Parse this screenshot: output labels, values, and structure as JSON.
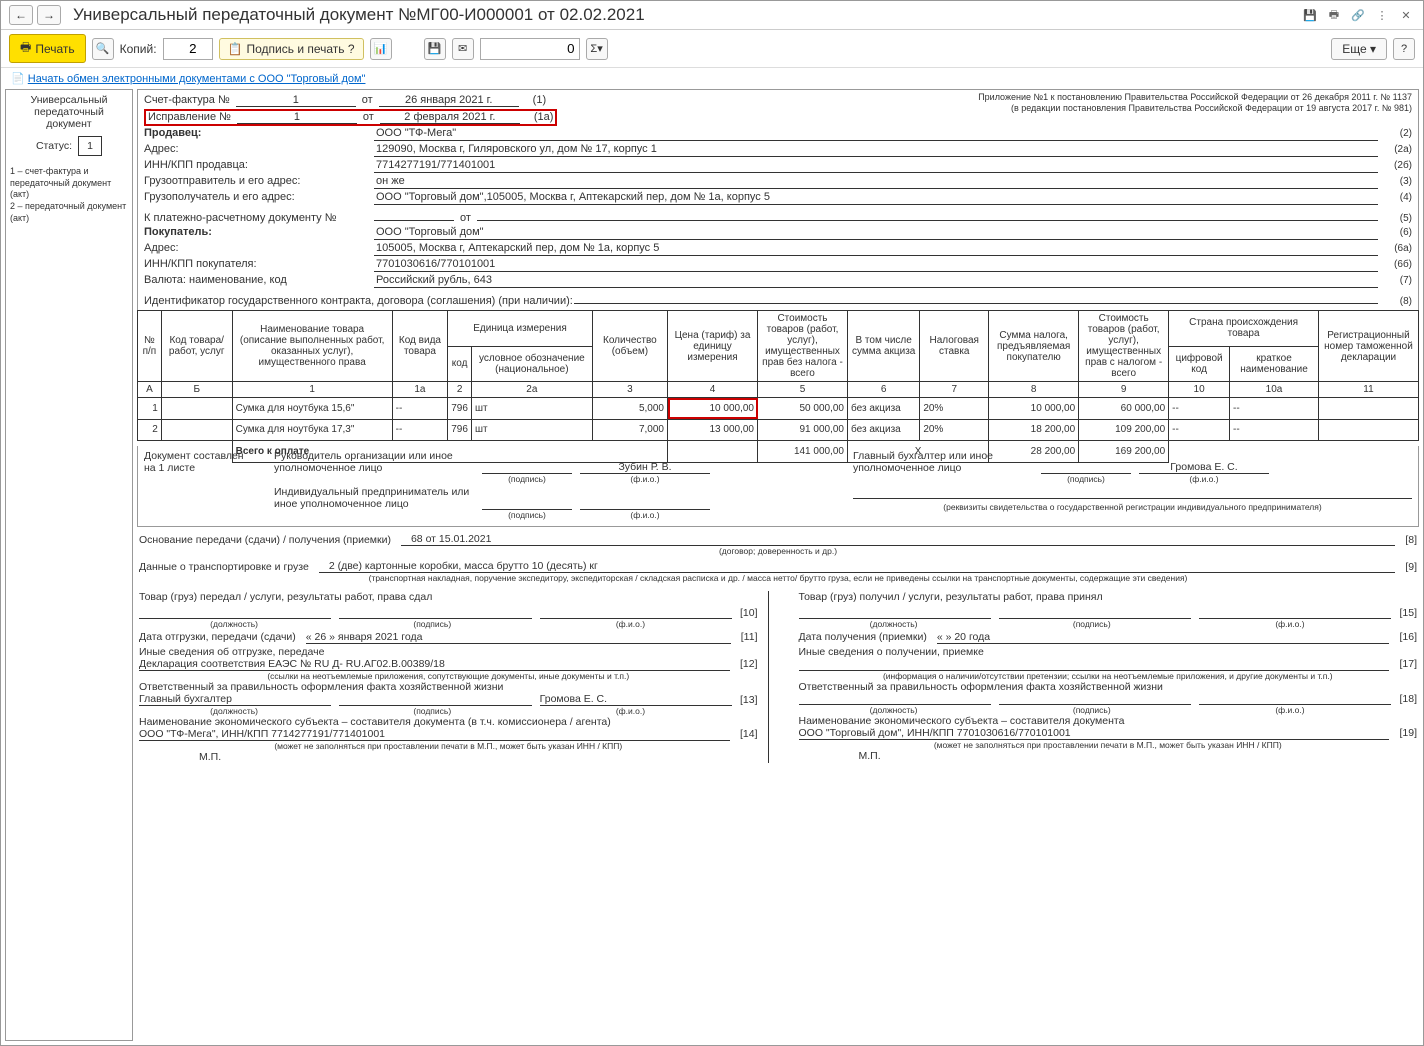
{
  "title": "Универсальный передаточный документ №МГ00-И000001 от 02.02.2021",
  "toolbar": {
    "print": "Печать",
    "copies_label": "Копий:",
    "copies": "2",
    "sign": "Подпись и печать ?",
    "sum": "0",
    "more": "Еще"
  },
  "link": "Начать обмен электронными документами с ООО \"Торговый дом\"",
  "sidebar": {
    "title": "Универсальный передаточный документ",
    "status_label": "Статус:",
    "status": "1",
    "note": "1 – счет-фактура и передаточный документ (акт)\n2 – передаточный документ (акт)"
  },
  "appendix1": "Приложение №1 к постановлению Правительства Российской Федерации от 26 декабря 2011 г. № 1137",
  "appendix2": "(в редакции постановления Правительства Российской Федерации от 19 августа 2017 г. № 981)",
  "sf": {
    "label": "Счет-фактура №",
    "num": "1",
    "ot": "от",
    "date": "26 января 2021 г.",
    "code": "(1)"
  },
  "corr": {
    "label": "Исправление №",
    "num": "1",
    "ot": "от",
    "date": "2 февраля 2021 г.",
    "code": "(1а)"
  },
  "hdr": {
    "seller_l": "Продавец:",
    "seller": "ООО \"ТФ-Мега\"",
    "c2": "(2)",
    "addr_l": "Адрес:",
    "addr": "129090, Москва г, Гиляровского ул, дом № 17, корпус 1",
    "c2a": "(2а)",
    "inn_l": "ИНН/КПП продавца:",
    "inn": "7714277191/771401001",
    "c26": "(2б)",
    "ship_l": "Грузоотправитель и его адрес:",
    "ship": "он же",
    "c3": "(3)",
    "cons_l": "Грузополучатель и его адрес:",
    "cons": "ООО \"Торговый дом\",105005, Москва г, Аптекарский пер, дом № 1а, корпус 5",
    "c4": "(4)",
    "pay_l": "К платежно-расчетному документу №",
    "pay": "",
    "pay_ot": "от",
    "c5": "(5)",
    "buyer_l": "Покупатель:",
    "buyer": "ООО \"Торговый дом\"",
    "c6": "(6)",
    "baddr_l": "Адрес:",
    "baddr": "105005, Москва г, Аптекарский пер, дом № 1а, корпус 5",
    "c6a": "(6а)",
    "binn_l": "ИНН/КПП покупателя:",
    "binn": "7701030616/770101001",
    "c66": "(6б)",
    "curr_l": "Валюта: наименование, код",
    "curr": "Российский рубль, 643",
    "c7": "(7)",
    "gos_l": "Идентификатор государственного контракта, договора (соглашения) (при наличии):",
    "gos": "",
    "c8": "(8)"
  },
  "th": {
    "num": "№ п/п",
    "code": "Код товара/ работ, услуг",
    "name": "Наименование товара (описание выполненных работ, оказанных услуг), имущественного права",
    "kind": "Код вида товара",
    "unit": "Единица измерения",
    "ucode": "код",
    "uname": "условное обозначение (национальное)",
    "qty": "Количество (объем)",
    "price": "Цена (тариф) за единицу измерения",
    "cost": "Стоимость товаров (работ, услуг), имущественных прав без налога - всего",
    "excise": "В том числе сумма акциза",
    "rate": "Налоговая ставка",
    "tax": "Сумма налога, предъявляемая покупателю",
    "total": "Стоимость товаров (работ, услуг), имущественных прав с налогом - всего",
    "country": "Страна происхождения товара",
    "ccode": "цифровой код",
    "cname": "краткое наименование",
    "decl": "Регистрационный номер таможенной декларации"
  },
  "tn": {
    "a": "А",
    "b": "Б",
    "c1": "1",
    "c1a": "1а",
    "c2": "2",
    "c2a": "2а",
    "c3": "3",
    "c4": "4",
    "c5": "5",
    "c6": "6",
    "c7": "7",
    "c8": "8",
    "c9": "9",
    "c10": "10",
    "c10a": "10а",
    "c11": "11"
  },
  "rows": [
    {
      "n": "1",
      "code": "",
      "name": "Сумка для ноутбука 15,6\"",
      "kind": "--",
      "uc": "796",
      "un": "шт",
      "qty": "5,000",
      "price": "10 000,00",
      "cost": "50 000,00",
      "exc": "без акциза",
      "rate": "20%",
      "tax": "10 000,00",
      "total": "60 000,00",
      "cc": "--",
      "cn": "--",
      "decl": ""
    },
    {
      "n": "2",
      "code": "",
      "name": "Сумка для ноутбука 17,3\"",
      "kind": "--",
      "uc": "796",
      "un": "шт",
      "qty": "7,000",
      "price": "13 000,00",
      "cost": "91 000,00",
      "exc": "без акциза",
      "rate": "20%",
      "tax": "18 200,00",
      "total": "109 200,00",
      "cc": "--",
      "cn": "--",
      "decl": ""
    }
  ],
  "totals": {
    "label": "Всего к оплате",
    "cost": "141 000,00",
    "x": "Х",
    "tax": "28 200,00",
    "total": "169 200,00"
  },
  "ftr": {
    "doc_pages": "Документ составлен на 1 листе",
    "head_l": "Руководитель организации или иное уполномоченное лицо",
    "head_name": "Зубин Р. В.",
    "acc_l": "Главный бухгалтер или иное уполномоченное лицо",
    "acc_name": "Громова Е. С.",
    "ip_l": "Индивидуальный предприниматель или иное уполномоченное лицо",
    "sign": "(подпись)",
    "fio": "(ф.и.о.)",
    "rekv": "(реквизиты свидетельства о государственной  регистрации индивидуального предпринимателя)",
    "basis_l": "Основание передачи (сдачи) / получения (приемки)",
    "basis": "68 от 15.01.2021",
    "basis_sub": "(договор; доверенность и др.)",
    "c8": "[8]",
    "trans_l": "Данные о транспортировке и грузе",
    "trans": "2 (две) картонные коробки, масса брутто 10 (десять) кг",
    "trans_sub": "(транспортная накладная, поручение экспедитору, экспедиторская / складская расписка и др. / масса нетто/ брутто груза, если не приведены ссылки на транспортные документы, содержащие эти сведения)",
    "c9": "[9]",
    "left": {
      "h1": "Товар (груз) передал / услуги, результаты работ, права сдал",
      "c10": "[10]",
      "pos": "(должность)",
      "date_l": "Дата отгрузки, передачи (сдачи)",
      "date": "« 26 »   января   2021   года",
      "c11": "[11]",
      "other_l": "Иные сведения об отгрузке, передаче",
      "other": "Декларация соответствия ЕАЭС № RU Д- RU.АГ02.В.00389/18",
      "other_sub": "(ссылки на неотъемлемые приложения, сопутствующие документы, иные документы и т.п.)",
      "c12": "[12]",
      "resp_l": "Ответственный за правильность оформления факта хозяйственной жизни",
      "resp_pos": "Главный бухгалтер",
      "resp_name": "Громова Е. С.",
      "c13": "[13]",
      "econ_l": "Наименование экономического субъекта – составителя документа (в т.ч. комиссионера / агента)",
      "econ": "ООО \"ТФ-Мега\", ИНН/КПП 7714277191/771401001",
      "econ_sub": "(может не заполняться при проставлении печати в М.П., может быть указан ИНН / КПП)",
      "c14": "[14]",
      "mp": "М.П."
    },
    "right": {
      "h1": "Товар (груз) получил / услуги, результаты работ, права принял",
      "c15": "[15]",
      "date_l": "Дата получения (приемки)",
      "date": "«      »                    20      года",
      "c16": "[16]",
      "other_l": "Иные сведения о получении, приемке",
      "other_sub": "(информация о наличии/отсутствии претензии; ссылки на неотъемлемые приложения, и другие  документы и т.п.)",
      "c17": "[17]",
      "resp_l": "Ответственный за правильность оформления факта хозяйственной жизни",
      "c18": "[18]",
      "econ_l": "Наименование экономического субъекта – составителя документа",
      "econ": "ООО \"Торговый дом\", ИНН/КПП 7701030616/770101001",
      "econ_sub": "(может не заполняться при проставлении печати в М.П., может быть указан ИНН / КПП)",
      "c19": "[19]",
      "mp": "М.П."
    }
  }
}
